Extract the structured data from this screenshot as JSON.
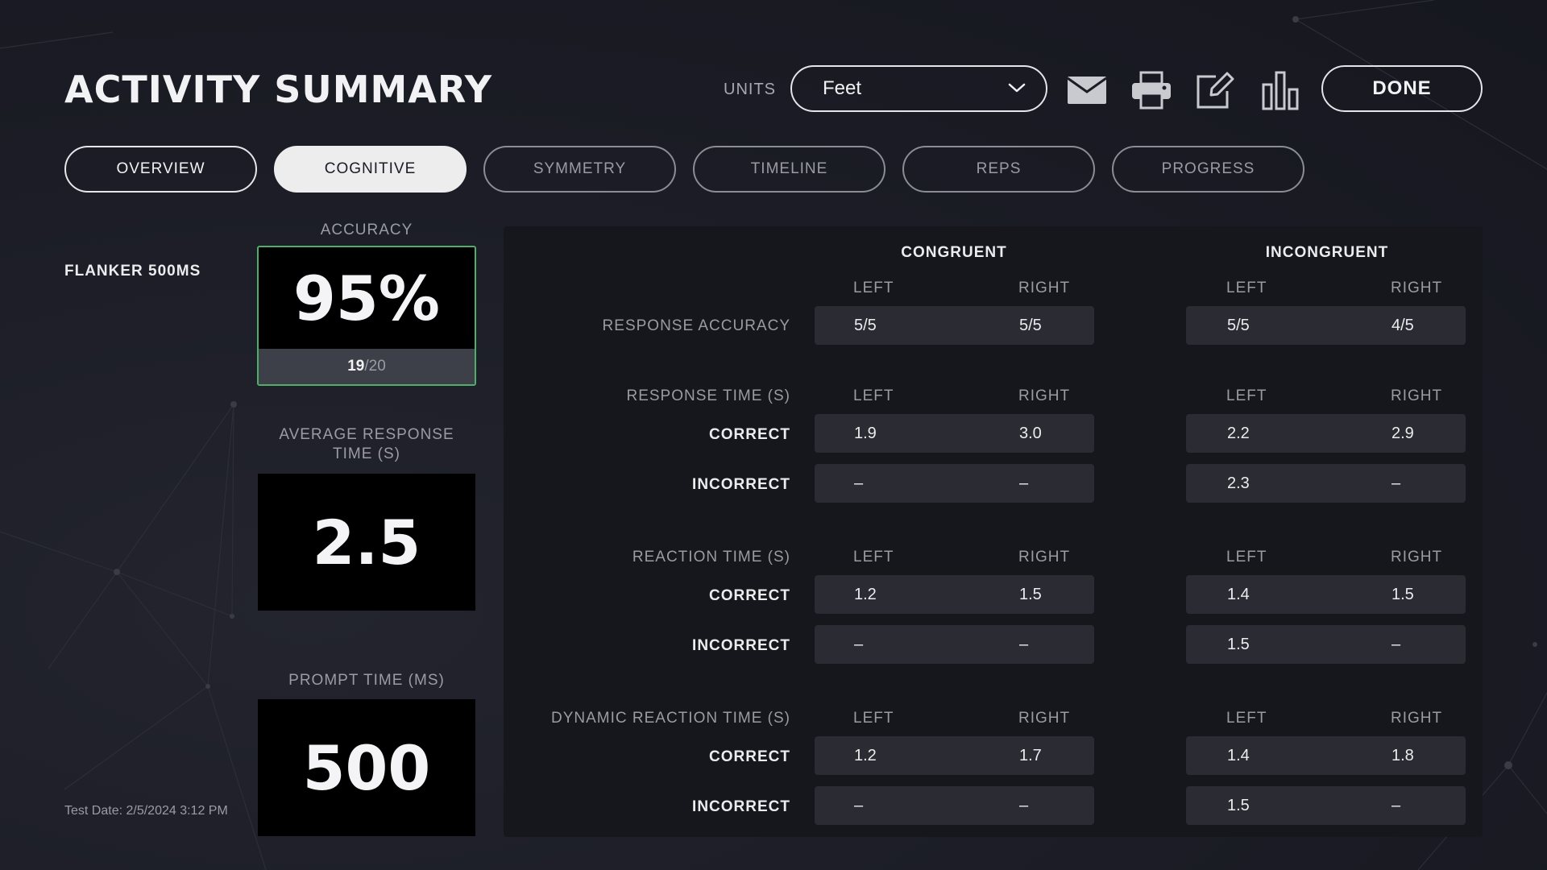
{
  "header": {
    "title": "ACTIVITY SUMMARY",
    "units_label": "UNITS",
    "units_value": "Feet",
    "done_label": "DONE",
    "icons": [
      "mail-icon",
      "print-icon",
      "edit-icon",
      "chart-icon"
    ]
  },
  "tabs": [
    {
      "label": "OVERVIEW",
      "state": "default"
    },
    {
      "label": "COGNITIVE",
      "state": "active"
    },
    {
      "label": "SYMMETRY",
      "state": "dim"
    },
    {
      "label": "TIMELINE",
      "state": "dim"
    },
    {
      "label": "REPS",
      "state": "dim"
    },
    {
      "label": "PROGRESS",
      "state": "dim"
    }
  ],
  "activity": {
    "name": "FLANKER 500MS",
    "test_date": "Test Date: 2/5/2024 3:12 PM"
  },
  "metrics": {
    "accuracy_label": "ACCURACY",
    "accuracy_value": "95%",
    "accuracy_correct": "19",
    "accuracy_total": "/20",
    "avg_response_label_1": "AVERAGE RESPONSE",
    "avg_response_label_2": "TIME (S)",
    "avg_response_value": "2.5",
    "prompt_label": "PROMPT TIME (MS)",
    "prompt_value": "500"
  },
  "table": {
    "groups": [
      "CONGRUENT",
      "INCONGRUENT"
    ],
    "left": "LEFT",
    "right": "RIGHT",
    "response_accuracy": {
      "label": "RESPONSE ACCURACY",
      "values": [
        "5/5",
        "5/5",
        "5/5",
        "4/5"
      ]
    },
    "response_time": {
      "label": "RESPONSE TIME (S)",
      "correct_label": "CORRECT",
      "incorrect_label": "INCORRECT",
      "correct": [
        "1.9",
        "3.0",
        "2.2",
        "2.9"
      ],
      "incorrect": [
        "–",
        "–",
        "2.3",
        "–"
      ]
    },
    "reaction_time": {
      "label": "REACTION TIME (S)",
      "correct_label": "CORRECT",
      "incorrect_label": "INCORRECT",
      "correct": [
        "1.2",
        "1.5",
        "1.4",
        "1.5"
      ],
      "incorrect": [
        "–",
        "–",
        "1.5",
        "–"
      ]
    },
    "dynamic_reaction_time": {
      "label": "DYNAMIC REACTION TIME (S)",
      "correct_label": "CORRECT",
      "incorrect_label": "INCORRECT",
      "correct": [
        "1.2",
        "1.7",
        "1.4",
        "1.8"
      ],
      "incorrect": [
        "–",
        "–",
        "1.5",
        "–"
      ]
    }
  },
  "colors": {
    "background": "#1b1c25",
    "panel": "#16171c",
    "cell": "#2a2b33",
    "accent_green": "#4fae68",
    "active_tab": "#ededee"
  }
}
